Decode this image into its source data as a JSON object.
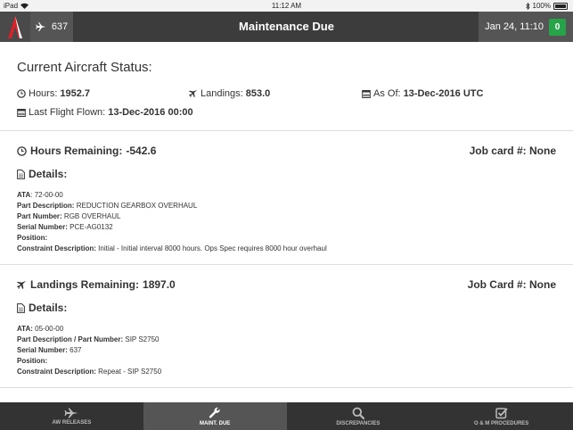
{
  "status_bar": {
    "device": "iPad",
    "time": "11:12 AM",
    "battery": "100%"
  },
  "nav": {
    "aircraft_number": "637",
    "title": "Maintenance Due",
    "datetime": "Jan 24, 11:10",
    "badge_count": "0"
  },
  "aircraft_status": {
    "title": "Current Aircraft Status:",
    "hours_label": "Hours:",
    "hours_value": "1952.7",
    "landings_label": "Landings:",
    "landings_value": "853.0",
    "as_of_label": "As Of:",
    "as_of_value": "13-Dec-2016 UTC",
    "last_flight_label": "Last Flight Flown:",
    "last_flight_value": "13-Dec-2016 00:00"
  },
  "cards": [
    {
      "remaining_label": "Hours Remaining:",
      "remaining_value": "-542.6",
      "job_card_label": "Job card #:",
      "job_card_value": "None",
      "details_title": "Details:",
      "fields": [
        {
          "label": "ATA",
          "sep": ": ",
          "value": "72-00-00"
        },
        {
          "label": "Part Description:",
          "sep": " ",
          "value": "REDUCTION GEARBOX OVERHAUL"
        },
        {
          "label": "Part Number:",
          "sep": " ",
          "value": "RGB OVERHAUL"
        },
        {
          "label": "Serial Number:",
          "sep": " ",
          "value": "PCE-AG0132"
        },
        {
          "label": "Position:",
          "sep": "",
          "value": ""
        },
        {
          "label": "Constraint Description:",
          "sep": " ",
          "value": "Initial - Initial interval 8000 hours. Ops Spec requires 8000 hour overhaul"
        }
      ]
    },
    {
      "remaining_label": "Landings Remaining:",
      "remaining_value": "1897.0",
      "job_card_label": "Job Card #:",
      "job_card_value": "None",
      "details_title": "Details:",
      "fields": [
        {
          "label": "ATA:",
          "sep": " ",
          "value": "05-00-00"
        },
        {
          "label": "Part Description / Part Number:",
          "sep": " ",
          "value": "SIP S2750"
        },
        {
          "label": "Serial Number:",
          "sep": " ",
          "value": "637"
        },
        {
          "label": "Position:",
          "sep": "",
          "value": ""
        },
        {
          "label": "Constraint Description:",
          "sep": " ",
          "value": "Repeat - SIP S2750"
        }
      ]
    }
  ],
  "tabs": [
    {
      "label": "AW RELEASES",
      "icon": "plane-icon"
    },
    {
      "label": "MAINT. DUE",
      "icon": "wrench-icon",
      "active": true
    },
    {
      "label": "DISCREPANCIES",
      "icon": "search-icon"
    },
    {
      "label": "O & M PROCEDURES",
      "icon": "checkbox-icon"
    }
  ],
  "colors": {
    "nav_bg": "#3c3c3c",
    "badge_green": "#27a34a",
    "logo_red": "#d9232a",
    "tab_bar_bg": "#333333"
  }
}
